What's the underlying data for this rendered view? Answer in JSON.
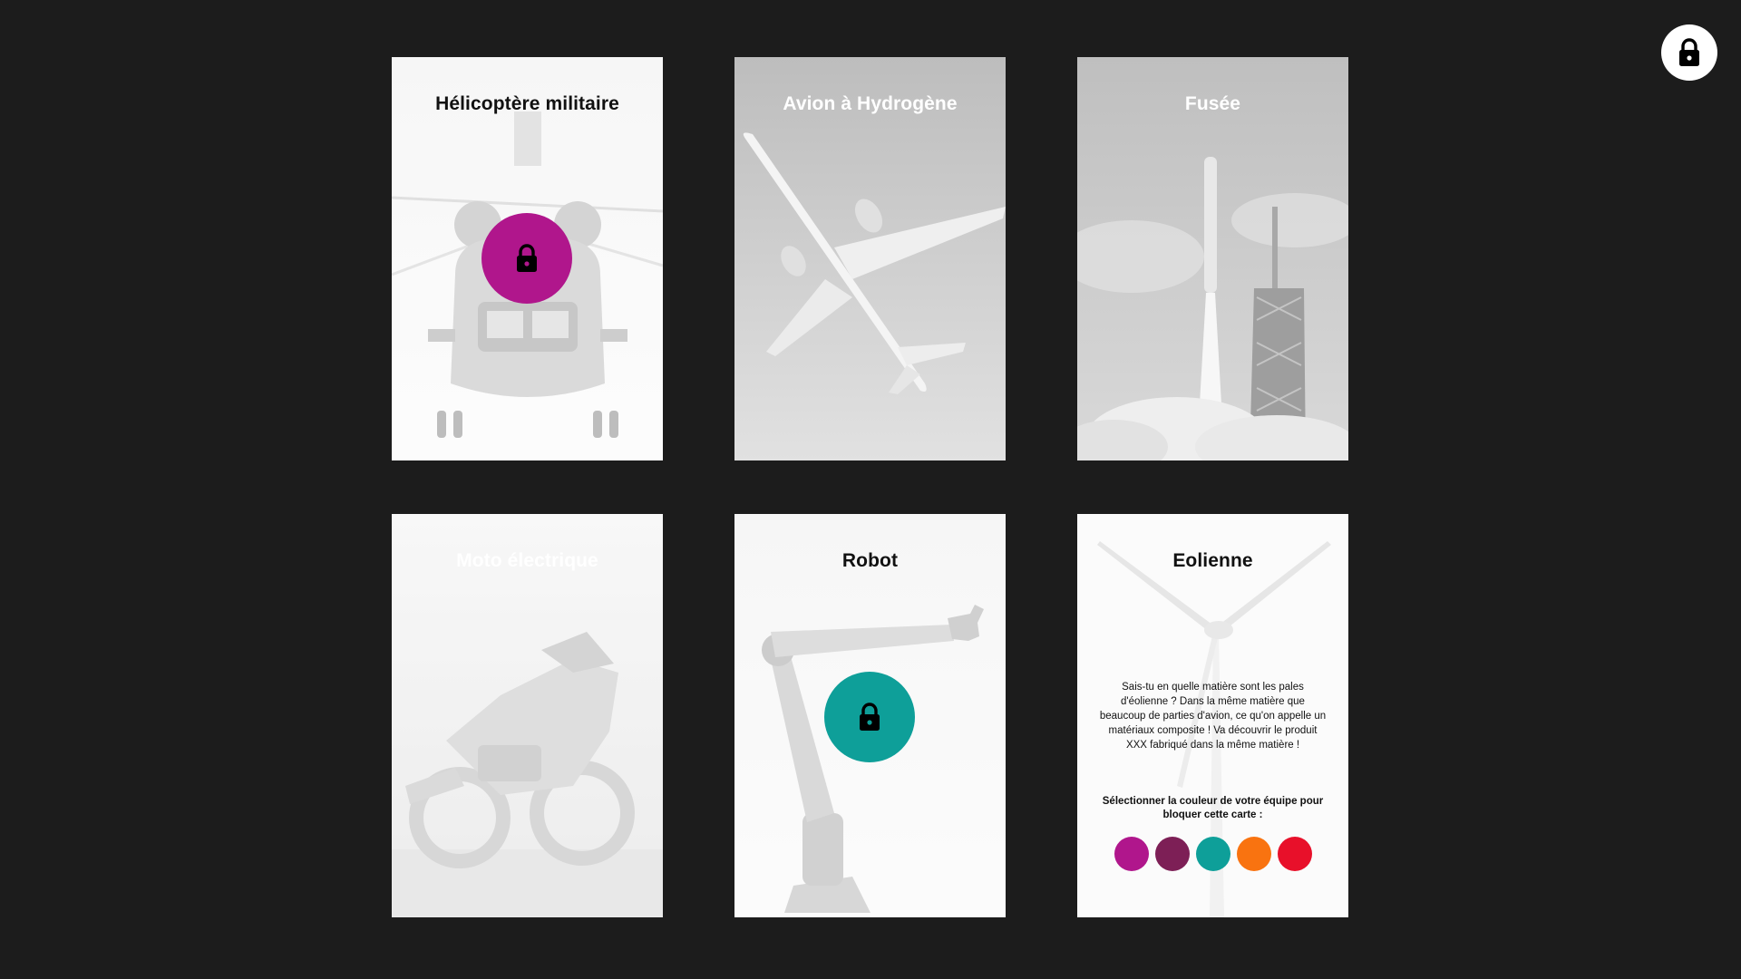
{
  "global_lock": {
    "icon": "lock-icon"
  },
  "cards": [
    {
      "title": "Hélicoptère militaire",
      "title_color": "#111111",
      "lock": {
        "visible": true,
        "color": "#b0168c",
        "icon": "lock-icon"
      }
    },
    {
      "title": "Avion à Hydrogène",
      "title_color": "#ffffff"
    },
    {
      "title": "Fusée",
      "title_color": "#ffffff"
    },
    {
      "title": "Moto électrique",
      "title_color": "#ffffff"
    },
    {
      "title": "Robot",
      "title_color": "#111111",
      "lock": {
        "visible": true,
        "color": "#0e9f99",
        "icon": "lock-icon"
      }
    },
    {
      "title": "Eolienne",
      "title_color": "#111111",
      "info_text": "Sais-tu en quelle matière sont les pales d'éolienne ? Dans la même matière que beaucoup de parties d'avion, ce qu'on appelle un matériaux composite ! Va découvrir le produit XXX fabriqué dans la même matière !",
      "prompt_text": "Sélectionner la couleur de votre équipe pour bloquer cette carte :",
      "team_colors": [
        "#b0168c",
        "#7d1f56",
        "#0e9f99",
        "#f97310",
        "#e8102a"
      ]
    }
  ]
}
